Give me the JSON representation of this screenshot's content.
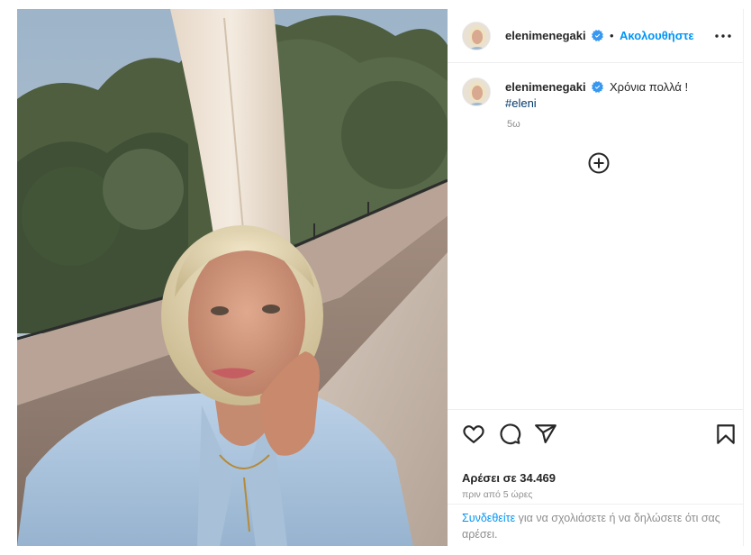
{
  "header": {
    "username": "elenimenegaki",
    "separator": "•",
    "follow_label": "Ακολουθήστε"
  },
  "caption": {
    "username": "elenimenegaki",
    "text": "Χρόνια πολλά !",
    "hashtag": "#eleni",
    "time": "5ω"
  },
  "post": {
    "likes": "Αρέσει σε 34.469",
    "posted_ago": "πριν από 5 ώρες"
  },
  "comment_bar": {
    "login_link": "Συνδεθείτε",
    "rest": " για να σχολιάσετε ή να δηλώσετε ότι σας αρέσει."
  },
  "icons": {
    "verified": "verified-badge-icon",
    "more": "more-options-icon",
    "add_comment": "plus-circle-icon",
    "like": "heart-icon",
    "comment": "comment-icon",
    "share": "share-icon",
    "save": "bookmark-icon"
  },
  "colors": {
    "link_blue": "#0095f6",
    "hashtag_blue": "#00376b",
    "verified_blue": "#3897f0",
    "muted_text": "#8e8e8e",
    "border": "#efefef"
  }
}
